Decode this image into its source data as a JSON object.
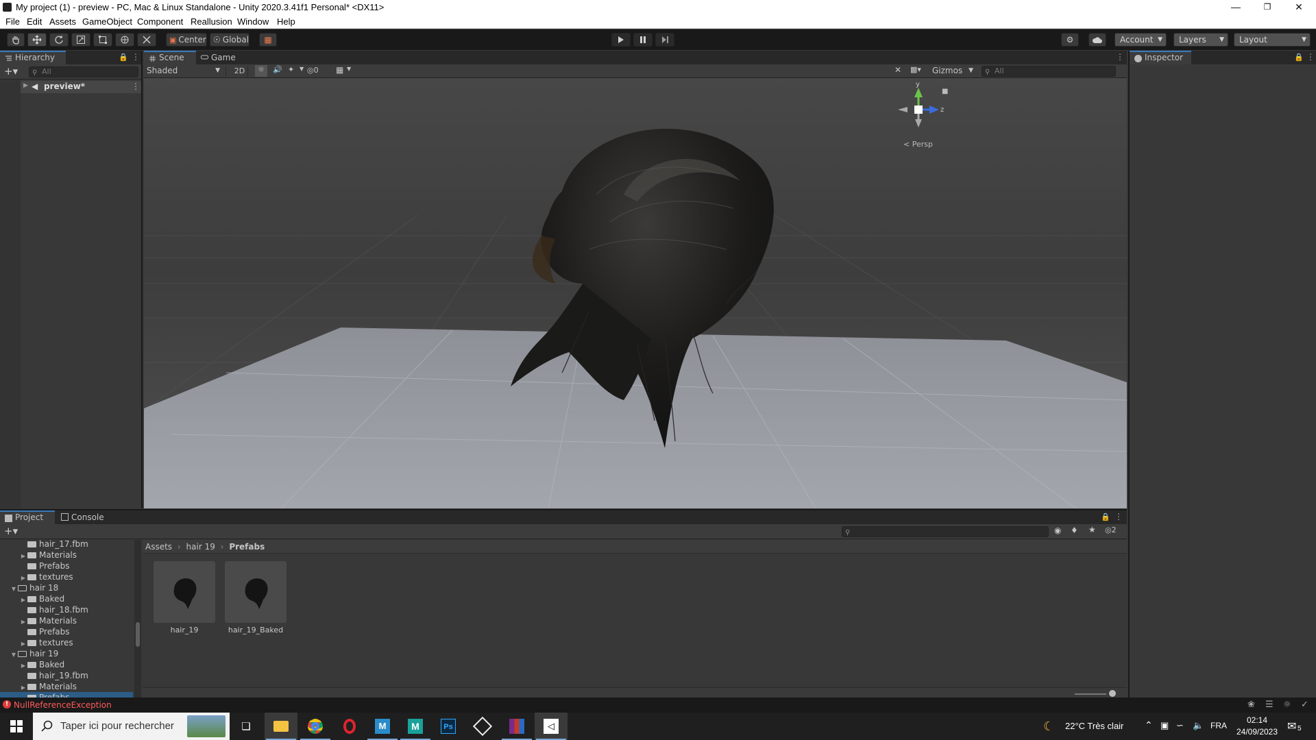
{
  "window": {
    "title": "My project (1) - preview - PC, Mac & Linux Standalone - Unity 2020.3.41f1 Personal* <DX11>",
    "minimize": "—",
    "maximize": "❐",
    "close": "✕"
  },
  "menu": [
    "File",
    "Edit",
    "Assets",
    "GameObject",
    "Component",
    "Reallusion",
    "Window",
    "Help"
  ],
  "toolbar": {
    "pivot_label": "Center",
    "space_label": "Global",
    "account_label": "Account",
    "layers_label": "Layers",
    "layout_label": "Layout"
  },
  "hierarchy": {
    "tab_label": "Hierarchy",
    "search_placeholder": "All",
    "root_item": "preview*"
  },
  "scene": {
    "tab_scene": "Scene",
    "tab_game": "Game",
    "shading_mode": "Shaded",
    "mode_2d": "2D",
    "hidden_count": "0",
    "gizmos_label": "Gizmos",
    "search_placeholder": "All",
    "axis_y": "y",
    "axis_z": "z",
    "projection": "Persp"
  },
  "inspector": {
    "tab_label": "Inspector"
  },
  "project": {
    "tab_project": "Project",
    "tab_console": "Console",
    "filter_count": "2",
    "breadcrumb": [
      "Assets",
      "hair 19",
      "Prefabs"
    ],
    "tree": [
      {
        "label": "hair_17.fbm",
        "depth": 2,
        "expanded": false,
        "has_children": false
      },
      {
        "label": "Materials",
        "depth": 2,
        "expanded": false,
        "has_children": true
      },
      {
        "label": "Prefabs",
        "depth": 2,
        "expanded": false,
        "has_children": false
      },
      {
        "label": "textures",
        "depth": 2,
        "expanded": false,
        "has_children": true
      },
      {
        "label": "hair 18",
        "depth": 1,
        "expanded": true,
        "has_children": true
      },
      {
        "label": "Baked",
        "depth": 2,
        "expanded": false,
        "has_children": true
      },
      {
        "label": "hair_18.fbm",
        "depth": 2,
        "expanded": false,
        "has_children": false
      },
      {
        "label": "Materials",
        "depth": 2,
        "expanded": false,
        "has_children": true
      },
      {
        "label": "Prefabs",
        "depth": 2,
        "expanded": false,
        "has_children": false
      },
      {
        "label": "textures",
        "depth": 2,
        "expanded": false,
        "has_children": true
      },
      {
        "label": "hair 19",
        "depth": 1,
        "expanded": true,
        "has_children": true
      },
      {
        "label": "Baked",
        "depth": 2,
        "expanded": false,
        "has_children": true
      },
      {
        "label": "hair_19.fbm",
        "depth": 2,
        "expanded": false,
        "has_children": false
      },
      {
        "label": "Materials",
        "depth": 2,
        "expanded": false,
        "has_children": true
      },
      {
        "label": "Prefabs",
        "depth": 2,
        "expanded": false,
        "has_children": false,
        "selected": true
      }
    ],
    "assets": [
      {
        "name": "hair_19"
      },
      {
        "name": "hair_19_Baked"
      }
    ]
  },
  "status": {
    "message": "NullReferenceException",
    "color": "#ff5b5b"
  },
  "taskbar": {
    "search_placeholder": "Taper ici pour rechercher",
    "weather": "22°C  Très clair",
    "language": "FRA",
    "time": "02:14",
    "date": "24/09/2023",
    "notifications": "5"
  }
}
